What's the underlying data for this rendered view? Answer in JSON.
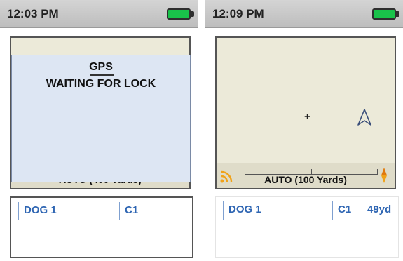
{
  "left_screen": {
    "status": {
      "time": "12:03 PM"
    },
    "map": {
      "scale_label": "AUTO (400 Yards)"
    },
    "gps_dialog": {
      "title": "GPS",
      "message": "WAITING FOR LOCK"
    },
    "dogs": [
      {
        "name": "DOG 1",
        "channel": "C1",
        "distance": ""
      }
    ]
  },
  "right_screen": {
    "status": {
      "time": "12:09 PM"
    },
    "map": {
      "scale_label": "AUTO (100 Yards)"
    },
    "dogs": [
      {
        "name": "DOG 1",
        "channel": "C1",
        "distance": "49yd"
      }
    ]
  },
  "colors": {
    "battery": "#19c24a",
    "text_blue": "#2f66b3",
    "dialog_bg": "#dde6f3",
    "map_bg": "#ecead9"
  }
}
